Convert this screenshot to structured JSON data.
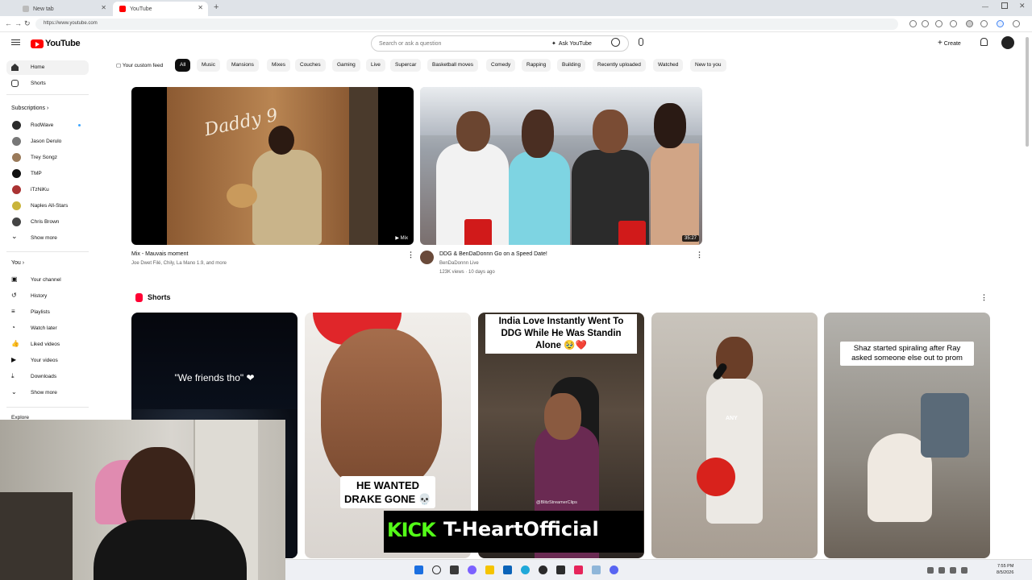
{
  "browser": {
    "tabs": [
      {
        "label": "New tab",
        "active": false
      },
      {
        "label": "YouTube",
        "active": true
      }
    ],
    "url": "https://www.youtube.com"
  },
  "header": {
    "logo_text": "YouTube",
    "search_placeholder": "Search or ask a question",
    "ask_label": "Ask YouTube",
    "create_label": "Create"
  },
  "chips": [
    "Your custom feed",
    "All",
    "Music",
    "Mansions",
    "Mixes",
    "Couches",
    "Gaming",
    "Live",
    "Supercar",
    "Basketball moves",
    "Comedy",
    "Rapping",
    "Building",
    "Recently uploaded",
    "Watched",
    "New to you"
  ],
  "sidebar": {
    "top": [
      {
        "label": "Home"
      },
      {
        "label": "Shorts"
      }
    ],
    "subscriptions_label": "Subscriptions",
    "subscriptions": [
      {
        "label": "RodWave"
      },
      {
        "label": "Jason Derulo"
      },
      {
        "label": "Trey Songz"
      },
      {
        "label": "TMP"
      },
      {
        "label": "iTzNiKu"
      },
      {
        "label": "Naples All-Stars"
      },
      {
        "label": "Chris Brown"
      },
      {
        "label": "Show more"
      }
    ],
    "you_label": "You",
    "you": [
      {
        "label": "Your channel"
      },
      {
        "label": "History"
      },
      {
        "label": "Playlists"
      },
      {
        "label": "Watch later"
      },
      {
        "label": "Liked videos"
      },
      {
        "label": "Your videos"
      },
      {
        "label": "Downloads"
      },
      {
        "label": "Show more"
      }
    ],
    "explore_label": "Explore"
  },
  "videos": [
    {
      "title": "Mix - Mauvais moment",
      "meta": "Joe Dwet Filé, Chily, La Mano 1.9, and more",
      "badge": "Mix",
      "thumb_text": "Daddy 9"
    },
    {
      "title": "DDG & BenDaDonnn Go on a Speed Date!",
      "channel": "BenDaDonnn Live",
      "meta": "123K views · 10 days ago",
      "badge": "35:27"
    }
  ],
  "shorts_section": {
    "label": "Shorts",
    "items": [
      {
        "caption": "\"We friends tho\" ❤"
      },
      {
        "caption": "HE WANTED DRAKE GONE 💀"
      },
      {
        "caption": "India Love Instantly Went To DDG While He Was Standin Alone 🥹❤️",
        "watermark": "@BlitzStreamerClips"
      },
      {
        "caption": "ANY"
      },
      {
        "caption": "Shaz started spiraling after Ray asked someone else out to prom"
      }
    ]
  },
  "overlay": {
    "kick_label": "KICK",
    "kick_handle": "T-HeartOfficial"
  },
  "taskbar": {
    "time": "7:55 PM",
    "date": "8/5/2026"
  }
}
